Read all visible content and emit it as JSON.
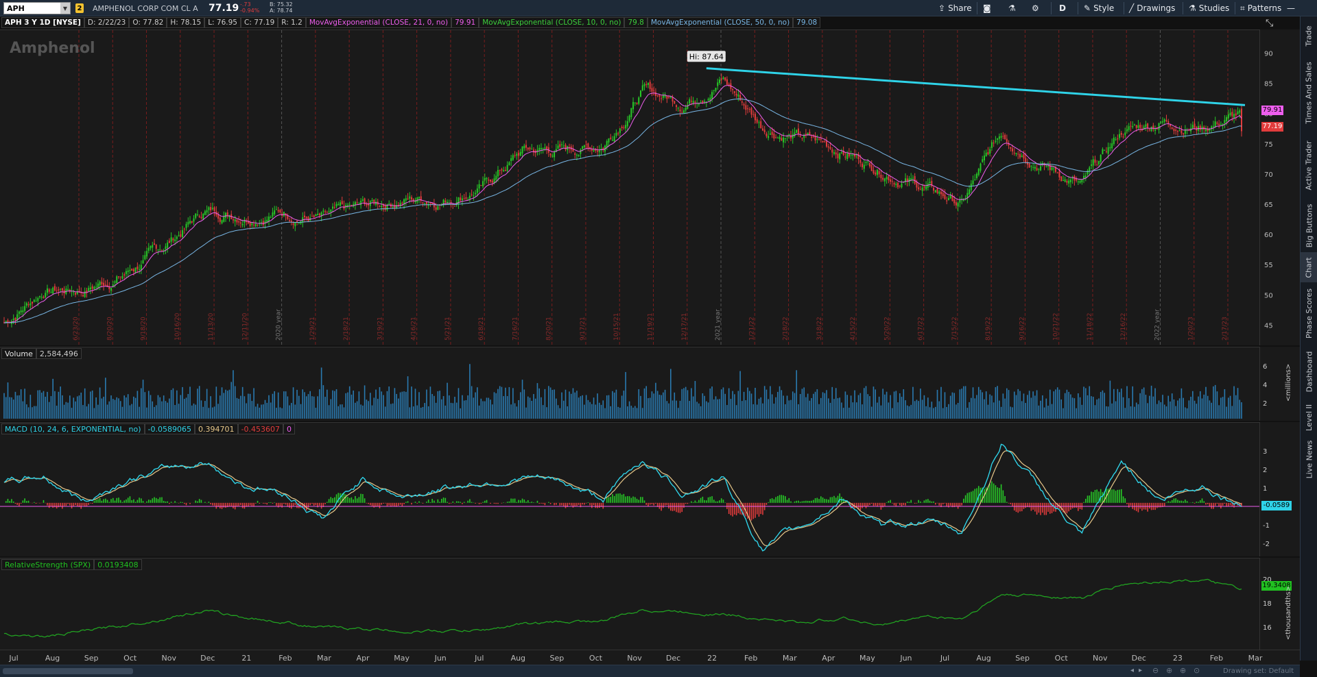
{
  "toolbar": {
    "symbol": "APH",
    "link_badge": "2",
    "company": "AMPHENOL CORP COM CL A",
    "last": "77.19",
    "change": "-.73",
    "change_pct": "-0.94%",
    "bid": "B: 75.32",
    "ask": "A: 78.74",
    "share_label": "Share",
    "period_label": "D",
    "style_label": "Style",
    "drawings_label": "Drawings",
    "studies_label": "Studies",
    "patterns_label": "Patterns"
  },
  "header": {
    "title": "APH 3 Y 1D [NYSE]",
    "date": "D: 2/22/23",
    "open": "O: 77.82",
    "high": "H: 78.15",
    "low": "L: 76.95",
    "close": "C: 77.19",
    "range": "R: 1.2",
    "ema21_label": "MovAvgExponential (CLOSE, 21, 0, no)",
    "ema21_value": "79.91",
    "ema10_label": "MovAvgExponential (CLOSE, 10, 0, no)",
    "ema10_value": "79.8",
    "ema50_label": "MovAvgExponential (CLOSE, 50, 0, no)",
    "ema50_value": "79.08"
  },
  "price_panel": {
    "watermark": "Amphenol",
    "hi_label": "Hi: 87.64",
    "price_tag_ema": "79.91",
    "price_tag_last": "77.19",
    "y_ticks": [
      "90",
      "85",
      "80",
      "75",
      "70",
      "65",
      "60",
      "55",
      "50",
      "45"
    ],
    "date_labels": [
      "6/23/20",
      "8/20/20",
      "9/18/20",
      "10/16/20",
      "11/13/20",
      "12/11/20",
      "2020 year",
      "1/29/21",
      "2/18/21",
      "3/19/21",
      "4/16/21",
      "5/21/21",
      "6/18/21",
      "7/16/21",
      "8/20/21",
      "9/17/21",
      "10/15/21",
      "11/19/21",
      "12/17/21",
      "2021 year",
      "1/21/22",
      "2/18/22",
      "3/18/22",
      "4/15/22",
      "5/20/22",
      "6/17/22",
      "7/15/22",
      "8/19/22",
      "9/16/22",
      "10/21/22",
      "11/18/22",
      "12/16/22",
      "2022 year",
      "1/20/23",
      "2/17/23"
    ]
  },
  "volume_panel": {
    "label": "Volume",
    "value": "2,584,496",
    "y_ticks": [
      "6",
      "4",
      "2"
    ],
    "unit": "<millions>"
  },
  "macd_panel": {
    "label": "MACD (10, 24, 6, EXPONENTIAL, no)",
    "value": "-0.0589065",
    "avg": "0.394701",
    "diff": "-0.453607",
    "zero": "0",
    "y_ticks": [
      "3",
      "2",
      "1",
      "-1",
      "-2"
    ],
    "tag": "-0.0589"
  },
  "rs_panel": {
    "label": "RelativeStrength (SPX)",
    "value": "0.0193408",
    "y_ticks": [
      "20",
      "18",
      "16"
    ],
    "tag": "19.3408",
    "unit": "<thousandths>"
  },
  "x_axis": {
    "months": [
      "Jul",
      "Aug",
      "Sep",
      "Oct",
      "Nov",
      "Dec",
      "21",
      "Feb",
      "Mar",
      "Apr",
      "May",
      "Jun",
      "Jul",
      "Aug",
      "Sep",
      "Oct",
      "Nov",
      "Dec",
      "22",
      "Feb",
      "Mar",
      "Apr",
      "May",
      "Jun",
      "Jul",
      "Aug",
      "Sep",
      "Oct",
      "Nov",
      "Dec",
      "23",
      "Feb",
      "Mar"
    ]
  },
  "side_tabs": [
    "Trade",
    "Times And Sales",
    "Active Trader",
    "Big Buttons",
    "Chart",
    "Phase Scores",
    "Dashboard",
    "Level II",
    "Live News"
  ],
  "status": {
    "drawing_set": "Drawing set: Default"
  },
  "chart_data": [
    {
      "type": "candlestick",
      "title": "APH 3 Y 1D [NYSE]",
      "ylim": [
        43,
        93
      ],
      "series": [
        {
          "name": "MovAvgExponential (CLOSE, 21, 0, no)",
          "last": 79.91
        },
        {
          "name": "MovAvgExponential (CLOSE, 10, 0, no)",
          "last": 79.8
        },
        {
          "name": "MovAvgExponential (CLOSE, 50, 0, no)",
          "last": 79.08
        }
      ],
      "x": [
        "Jul 20",
        "Aug 20",
        "Sep 20",
        "Oct 20",
        "Nov 20",
        "Dec 20",
        "Jan 21",
        "Feb 21",
        "Mar 21",
        "Apr 21",
        "May 21",
        "Jun 21",
        "Jul 21",
        "Aug 21",
        "Sep 21",
        "Oct 21",
        "Nov 21",
        "Dec 21",
        "Jan 22",
        "Feb 22",
        "Mar 22",
        "Apr 22",
        "May 22",
        "Jun 22",
        "Jul 22",
        "Aug 22",
        "Sep 22",
        "Oct 22",
        "Nov 22",
        "Dec 22",
        "Jan 23",
        "Feb 23"
      ],
      "close": [
        45.5,
        51,
        51,
        53.5,
        58,
        64,
        63.5,
        64,
        62.5,
        64.5,
        66,
        66,
        68,
        74,
        74,
        75,
        84,
        82,
        86,
        78,
        76,
        74,
        71,
        68,
        65,
        77,
        72,
        68,
        77,
        79,
        78,
        80
      ],
      "annotations": {
        "high": 87.64,
        "trendline": [
          [
            "Dec 21",
            87.6
          ],
          [
            "Feb 23",
            81.5
          ]
        ]
      }
    },
    {
      "type": "bar",
      "title": "Volume",
      "ylabel": "<millions>",
      "ylim": [
        0,
        7
      ],
      "last": 2584496
    },
    {
      "type": "line",
      "title": "MACD (10, 24, 6, EXPONENTIAL, no)",
      "ylim": [
        -2.5,
        3.5
      ],
      "x": [
        "Jul 20",
        "Aug 20",
        "Sep 20",
        "Oct 20",
        "Nov 20",
        "Dec 20",
        "Jan 21",
        "Feb 21",
        "Mar 21",
        "Apr 21",
        "May 21",
        "Jun 21",
        "Jul 21",
        "Aug 21",
        "Sep 21",
        "Oct 21",
        "Nov 21",
        "Dec 21",
        "Jan 22",
        "Feb 22",
        "Mar 22",
        "Apr 22",
        "May 22",
        "Jun 22",
        "Jul 22",
        "Aug 22",
        "Sep 22",
        "Oct 22",
        "Nov 22",
        "Dec 22",
        "Jan 23",
        "Feb 23"
      ],
      "values": [
        1.0,
        1.4,
        0.1,
        1.2,
        1.7,
        2.2,
        1.0,
        0.6,
        -0.8,
        1.3,
        0.3,
        0.8,
        1.1,
        1.4,
        1.0,
        0.2,
        2.3,
        0.6,
        1.3,
        -2.4,
        -1.3,
        0.3,
        -1.4,
        -0.9,
        -1.6,
        3.3,
        0.6,
        -1.9,
        2.1,
        0.2,
        1.0,
        -0.06
      ]
    },
    {
      "type": "line",
      "title": "RelativeStrength (SPX)",
      "ylabel": "<thousandths>",
      "ylim": [
        14.5,
        21
      ],
      "x": [
        "Jul 20",
        "Aug 20",
        "Sep 20",
        "Oct 20",
        "Nov 20",
        "Dec 20",
        "Jan 21",
        "Feb 21",
        "Mar 21",
        "Apr 21",
        "May 21",
        "Jun 21",
        "Jul 21",
        "Aug 21",
        "Sep 21",
        "Oct 21",
        "Nov 21",
        "Dec 21",
        "Jan 22",
        "Feb 22",
        "Mar 22",
        "Apr 22",
        "May 22",
        "Jun 22",
        "Jul 22",
        "Aug 22",
        "Sep 22",
        "Oct 22",
        "Nov 22",
        "Dec 22",
        "Jan 23",
        "Feb 23"
      ],
      "values": [
        15.5,
        15.2,
        15.7,
        16.2,
        16.8,
        17.5,
        16.9,
        16.5,
        16.0,
        15.9,
        15.7,
        15.7,
        15.8,
        16.3,
        16.5,
        16.6,
        17.6,
        17.4,
        17.2,
        16.8,
        16.4,
        16.9,
        16.2,
        17.0,
        16.8,
        18.9,
        18.8,
        18.6,
        19.8,
        20.1,
        20.2,
        19.34
      ]
    }
  ],
  "colors": {
    "up": "#27c927",
    "down": "#e23c3c",
    "ema_fast": "#ee5eee",
    "ema_slow": "#79b7e6",
    "trendline": "#2fd3e8",
    "macd": "#2fd3e8",
    "macd_avg": "#e8c88a",
    "rs": "#21a121"
  }
}
